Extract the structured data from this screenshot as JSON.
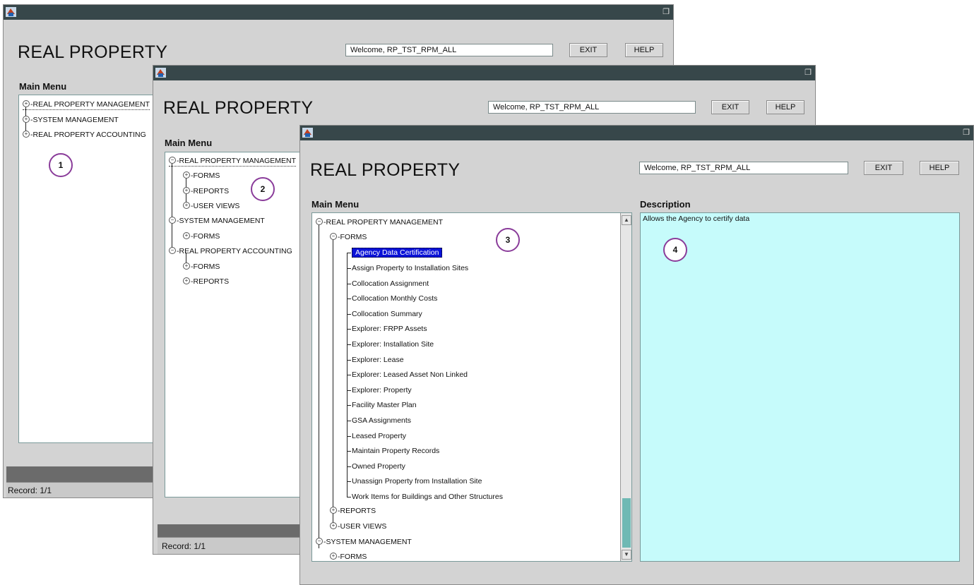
{
  "app": {
    "title": "REAL PROPERTY",
    "welcome": "Welcome, RP_TST_RPM_ALL",
    "exit_label": "EXIT",
    "help_label": "HELP",
    "main_menu_label": "Main Menu",
    "record": "Record: 1/1",
    "description_label": "Description",
    "description_text": "Allows the Agency to certify data",
    "restore_icon": "❐"
  },
  "window1": {
    "tree": [
      "REAL PROPERTY MANAGEMENT",
      "SYSTEM MANAGEMENT",
      "REAL PROPERTY ACCOUNTING"
    ],
    "callout": "1"
  },
  "window2": {
    "rpm": "REAL PROPERTY MANAGEMENT",
    "rpm_children": [
      "FORMS",
      "REPORTS",
      "USER VIEWS"
    ],
    "sys": "SYSTEM MANAGEMENT",
    "sys_children": [
      "FORMS"
    ],
    "acc": "REAL PROPERTY ACCOUNTING",
    "acc_children": [
      "FORMS",
      "REPORTS"
    ],
    "callout": "2"
  },
  "window3": {
    "rpm": "REAL PROPERTY MANAGEMENT",
    "forms": "FORMS",
    "selected": "Agency Data Certification",
    "form_items": [
      "Assign Property to Installation Sites",
      "Collocation Assignment",
      "Collocation Monthly Costs",
      "Collocation Summary",
      "Explorer: FRPP Assets",
      "Explorer: Installation Site",
      "Explorer: Lease",
      "Explorer: Leased Asset Non Linked",
      "Explorer: Property",
      "Facility Master Plan",
      "GSA Assignments",
      "Leased Property",
      "Maintain Property Records",
      "Owned Property",
      "Unassign Property from Installation Site",
      "Work Items for Buildings and Other Structures"
    ],
    "reports": "REPORTS",
    "user_views": "USER VIEWS",
    "sys": "SYSTEM MANAGEMENT",
    "sys_forms": "FORMS",
    "callout_tree": "3",
    "callout_desc": "4"
  },
  "colors": {
    "titlebar": "#37474a",
    "window_bg": "#d3d3d3",
    "selection": "#0a12d8",
    "description_bg": "#c6fbfb",
    "callout_border": "#8a3c9a"
  }
}
